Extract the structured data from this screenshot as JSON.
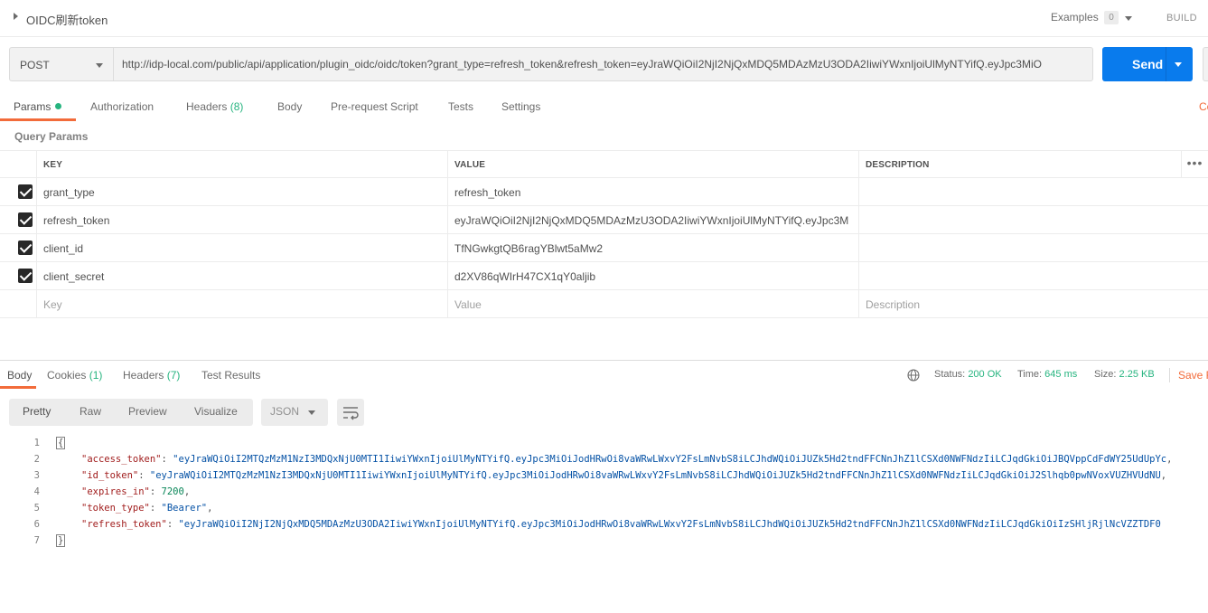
{
  "header": {
    "title": "OIDC刷新token",
    "examples_label": "Examples",
    "examples_count": "0",
    "build_label": "BUILD"
  },
  "request": {
    "method": "POST",
    "url": "http://idp-local.com/public/api/application/plugin_oidc/oidc/token?grant_type=refresh_token&refresh_token=eyJraWQiOiI2NjI2NjQxMDQ5MDAzMzU3ODA2IiwiYWxnIjoiUlMyNTYifQ.eyJpc3MiO",
    "send_label": "Send"
  },
  "tabs": [
    {
      "label": "Params",
      "extra": ""
    },
    {
      "label": "Authorization",
      "extra": ""
    },
    {
      "label": "Headers",
      "extra": "(8)"
    },
    {
      "label": "Body",
      "extra": ""
    },
    {
      "label": "Pre-request Script",
      "extra": ""
    },
    {
      "label": "Tests",
      "extra": ""
    },
    {
      "label": "Settings",
      "extra": ""
    }
  ],
  "cookies_link": "Co",
  "query_params": {
    "label": "Query Params",
    "columns": {
      "key": "KEY",
      "value": "VALUE",
      "description": "DESCRIPTION"
    },
    "more_glyph": "•••",
    "rows": [
      {
        "key": "grant_type",
        "value": "refresh_token",
        "description": ""
      },
      {
        "key": "refresh_token",
        "value": "eyJraWQiOiI2NjI2NjQxMDQ5MDAzMzU3ODA2IiwiYWxnIjoiUlMyNTYifQ.eyJpc3M",
        "description": ""
      },
      {
        "key": "client_id",
        "value": "TfNGwkgtQB6ragYBlwt5aMw2",
        "description": ""
      },
      {
        "key": "client_secret",
        "value": "d2XV86qWIrH47CX1qY0aljib",
        "description": ""
      }
    ],
    "placeholder": {
      "key": "Key",
      "value": "Value",
      "description": "Description"
    }
  },
  "response": {
    "tabs": [
      {
        "label": "Body",
        "extra": ""
      },
      {
        "label": "Cookies",
        "extra": "(1)"
      },
      {
        "label": "Headers",
        "extra": "(7)"
      },
      {
        "label": "Test Results",
        "extra": ""
      }
    ],
    "status_label": "Status:",
    "status_value": "200 OK",
    "time_label": "Time:",
    "time_value": "645 ms",
    "size_label": "Size:",
    "size_value": "2.25 KB",
    "save_label": "Save R",
    "views": [
      "Pretty",
      "Raw",
      "Preview",
      "Visualize"
    ],
    "format": "JSON",
    "code_lines": [
      {
        "n": "1",
        "k": "",
        "v": "",
        "type": "open"
      },
      {
        "n": "2",
        "k": "\"access_token\"",
        "v": "\"eyJraWQiOiI2MTQzMzM1NzI3MDQxNjU0MTI1IiwiYWxnIjoiUlMyNTYifQ.eyJpc3MiOiJodHRwOi8vaWRwLWxvY2FsLmNvbS8iLCJhdWQiOiJUZk5Hd2tndFFCNnJhZ1lCSXd0NWFNdzIiLCJqdGkiOiJBQVppCdFdWY25UdUpYc",
        "type": "str"
      },
      {
        "n": "3",
        "k": "\"id_token\"",
        "v": "\"eyJraWQiOiI2MTQzMzM1NzI3MDQxNjU0MTI1IiwiYWxnIjoiUlMyNTYifQ.eyJpc3MiOiJodHRwOi8vaWRwLWxvY2FsLmNvbS8iLCJhdWQiOiJUZk5Hd2tndFFCNnJhZ1lCSXd0NWFNdzIiLCJqdGkiOiJ2Slhqb0pwNVoxVUZHVUdNU",
        "type": "str"
      },
      {
        "n": "4",
        "k": "\"expires_in\"",
        "v": "7200",
        "type": "num"
      },
      {
        "n": "5",
        "k": "\"token_type\"",
        "v": "\"Bearer\"",
        "type": "str"
      },
      {
        "n": "6",
        "k": "\"refresh_token\"",
        "v": "\"eyJraWQiOiI2NjI2NjQxMDQ5MDAzMzU3ODA2IiwiYWxnIjoiUlMyNTYifQ.eyJpc3MiOiJodHRwOi8vaWRwLWxvY2FsLmNvbS8iLCJhdWQiOiJUZk5Hd2tndFFCNnJhZ1lCSXd0NWFNdzIiLCJqdGkiOiIzSHljRjlNcVZZTDF0",
        "type": "str"
      },
      {
        "n": "7",
        "k": "",
        "v": "",
        "type": "close"
      }
    ]
  },
  "colors": {
    "accent": "#f26b3a",
    "send": "#097bed",
    "success": "#26b47f"
  }
}
